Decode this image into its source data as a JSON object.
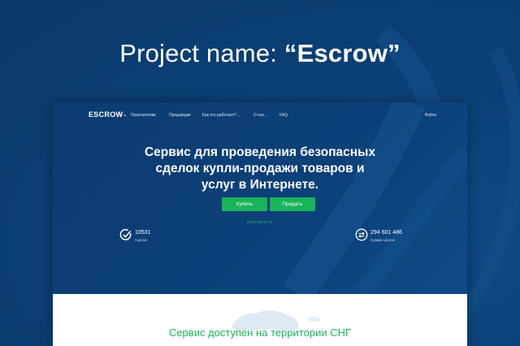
{
  "project": {
    "prefix": "Project name: ",
    "name": "“Escrow”"
  },
  "nav": {
    "logo": "ESCROW",
    "logo_mark": "™",
    "items": [
      {
        "label": "Покупателям"
      },
      {
        "label": "Продавцам"
      },
      {
        "label": "Как это работает?"
      },
      {
        "label": "О нас"
      },
      {
        "label": "FAQ"
      }
    ],
    "login": "Войти"
  },
  "hero": {
    "title_lines": [
      "Сервис для проведения безопасных",
      "сделок купли-продажи товаров и",
      "услуг в Интернете."
    ],
    "buy_label": "Купить",
    "sell_label": "Продать",
    "calc_label": "РАССЧИТАТЬ"
  },
  "stats": {
    "deals": {
      "value": "10531",
      "label": "Сделок",
      "icon": "checkmark-circle-icon"
    },
    "amount": {
      "value": "294 601 486",
      "label": "Сумма сделок",
      "icon": "exchange-arrows-icon"
    }
  },
  "lower": {
    "title": "Сервис доступен на территории СНГ"
  },
  "colors": {
    "background": "#0b3f74",
    "accent_green": "#19b35a",
    "text_white": "#ffffff"
  }
}
